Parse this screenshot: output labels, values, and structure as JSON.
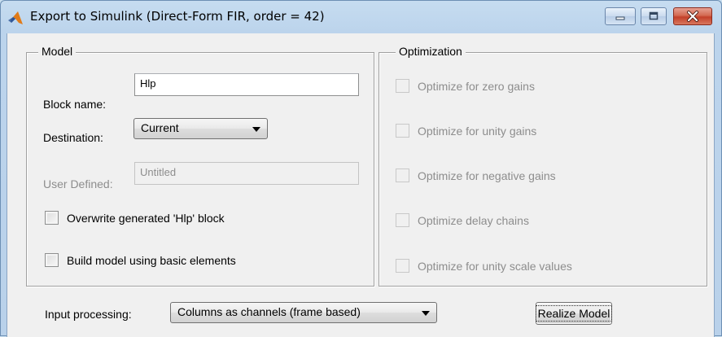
{
  "window": {
    "title": "Export to Simulink (Direct-Form FIR, order = 42)",
    "controls": {
      "minimize": "minimize-icon",
      "maximize": "maximize-icon",
      "close": "close-icon"
    },
    "accent_close": "#c3402a"
  },
  "model": {
    "legend": "Model",
    "block_name_label": "Block name:",
    "block_name_value": "Hlp",
    "destination_label": "Destination:",
    "destination_value": "Current",
    "user_defined_label": "User Defined:",
    "user_defined_value": "Untitled",
    "overwrite_label": "Overwrite generated 'Hlp' block",
    "overwrite_checked": false,
    "basic_elements_label": "Build model using basic elements",
    "basic_elements_checked": false
  },
  "optimization": {
    "legend": "Optimization",
    "options": [
      {
        "label": "Optimize for zero gains",
        "checked": false,
        "enabled": false
      },
      {
        "label": "Optimize for unity gains",
        "checked": false,
        "enabled": false
      },
      {
        "label": "Optimize for negative gains",
        "checked": false,
        "enabled": false
      },
      {
        "label": "Optimize delay chains",
        "checked": false,
        "enabled": false
      },
      {
        "label": "Optimize for unity scale values",
        "checked": false,
        "enabled": false
      }
    ]
  },
  "footer": {
    "input_processing_label": "Input processing:",
    "input_processing_value": "Columns as channels (frame based)",
    "realize_button": "Realize Model"
  }
}
